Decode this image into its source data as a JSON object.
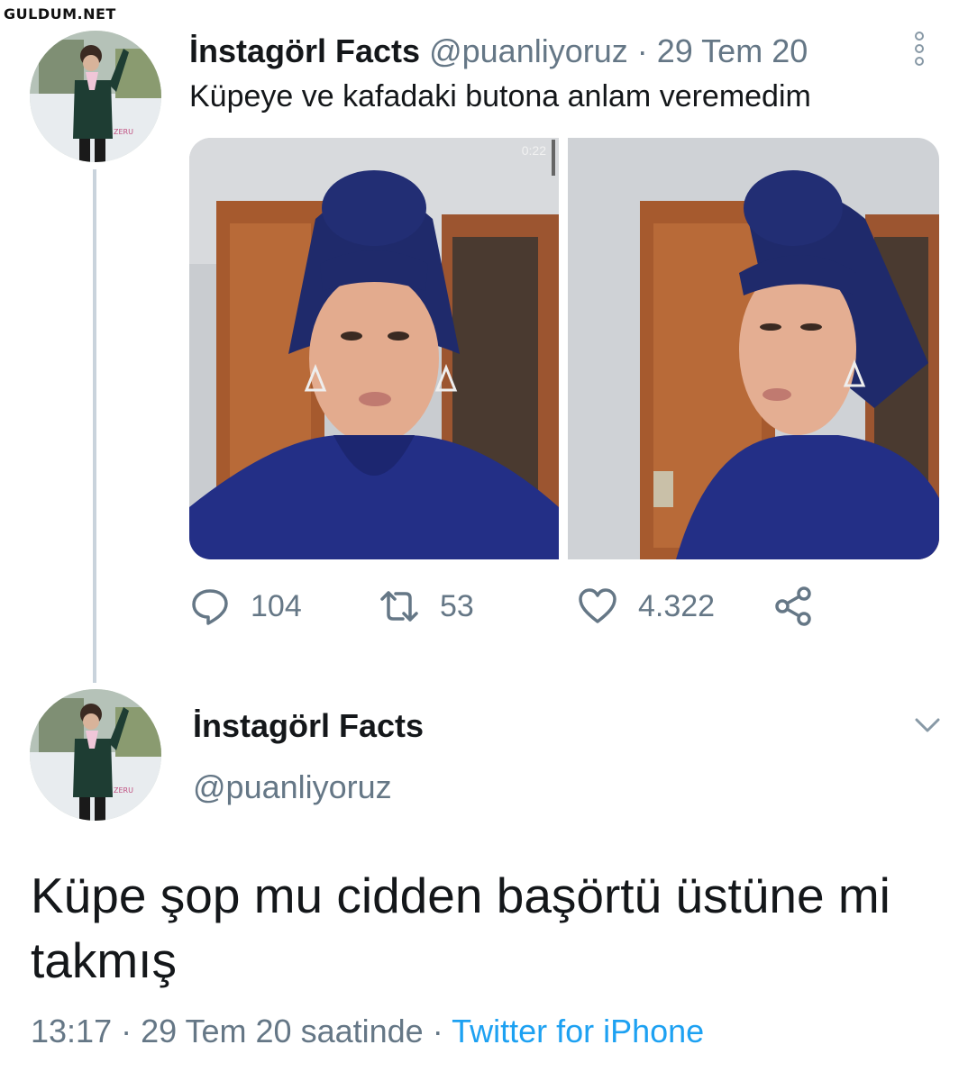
{
  "watermark": "GULDUM.NET",
  "tweet1": {
    "display_name": "İnstagörl Facts",
    "handle": "@puanliyoruz",
    "separator": "·",
    "date": "29 Tem 20",
    "text": "Küpeye ve kafadaki butona anlam veremedim",
    "video_duration": "0:22",
    "stats": {
      "replies": "104",
      "retweets": "53",
      "likes": "4.322"
    }
  },
  "tweet2": {
    "display_name": "İnstagörl Facts",
    "handle": "@puanliyoruz",
    "text": "Küpe şop mu cidden başörtü üstüne mi takmış",
    "time": "13:17",
    "separator": "·",
    "date_text": "29 Tem 20 saatinde",
    "separator2": "·",
    "source": "Twitter for iPhone"
  },
  "colors": {
    "handle_gray": "#657786",
    "link_blue": "#1da1f2",
    "thread_line": "#c9d3dc"
  },
  "icons": {
    "reply": "speech-bubble",
    "retweet": "retweet-arrows",
    "like": "heart",
    "share": "share-nodes",
    "more": "vertical-dots",
    "caret": "chevron-down"
  }
}
